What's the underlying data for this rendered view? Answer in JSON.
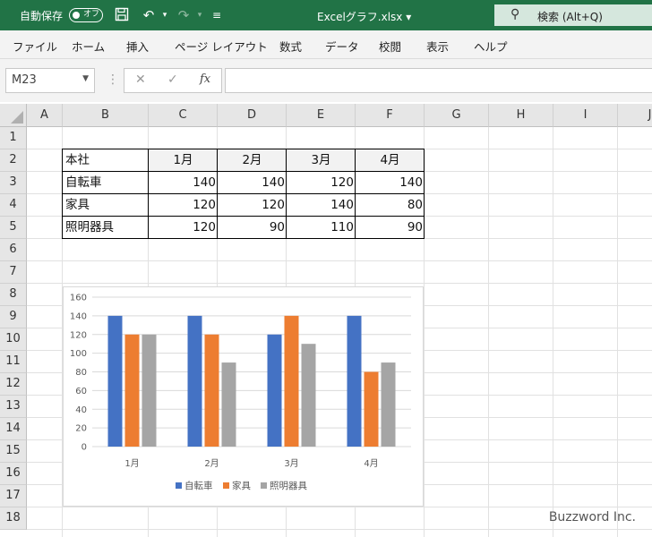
{
  "titlebar": {
    "autosave_label": "自動保存",
    "autosave_state": "オフ",
    "file_title": "Excelグラフ.xlsx ▾",
    "search_label": "検索 (Alt+Q)"
  },
  "menu": [
    "ファイル",
    "ホーム",
    "挿入",
    "ページ レイアウト",
    "数式",
    "データ",
    "校閲",
    "表示",
    "ヘルプ"
  ],
  "formula_bar": {
    "name_box": "M23",
    "fx_label": "fx",
    "formula": ""
  },
  "columns": [
    "A",
    "B",
    "C",
    "D",
    "E",
    "F",
    "G",
    "H",
    "I",
    "J"
  ],
  "rows": [
    "1",
    "2",
    "3",
    "4",
    "5",
    "6",
    "7",
    "8",
    "9",
    "10",
    "11",
    "12",
    "13",
    "14",
    "15",
    "16",
    "17",
    "18"
  ],
  "table": {
    "header": [
      "本社",
      "1月",
      "2月",
      "3月",
      "4月"
    ],
    "rows": [
      [
        "自転車",
        "140",
        "140",
        "120",
        "140"
      ],
      [
        "家具",
        "120",
        "120",
        "140",
        "80"
      ],
      [
        "照明器具",
        "120",
        "90",
        "110",
        "90"
      ]
    ]
  },
  "chart_data": {
    "type": "bar",
    "categories": [
      "1月",
      "2月",
      "3月",
      "4月"
    ],
    "series": [
      {
        "name": "自転車",
        "values": [
          140,
          140,
          120,
          140
        ],
        "color": "#4472c4"
      },
      {
        "name": "家具",
        "values": [
          120,
          120,
          140,
          80
        ],
        "color": "#ed7d31"
      },
      {
        "name": "照明器具",
        "values": [
          120,
          90,
          110,
          90
        ],
        "color": "#a5a5a5"
      }
    ],
    "ylim": [
      0,
      160
    ],
    "yticks": [
      0,
      20,
      40,
      60,
      80,
      100,
      120,
      140,
      160
    ],
    "grid": true,
    "legend": "bottom"
  },
  "watermark": "Buzzword Inc."
}
